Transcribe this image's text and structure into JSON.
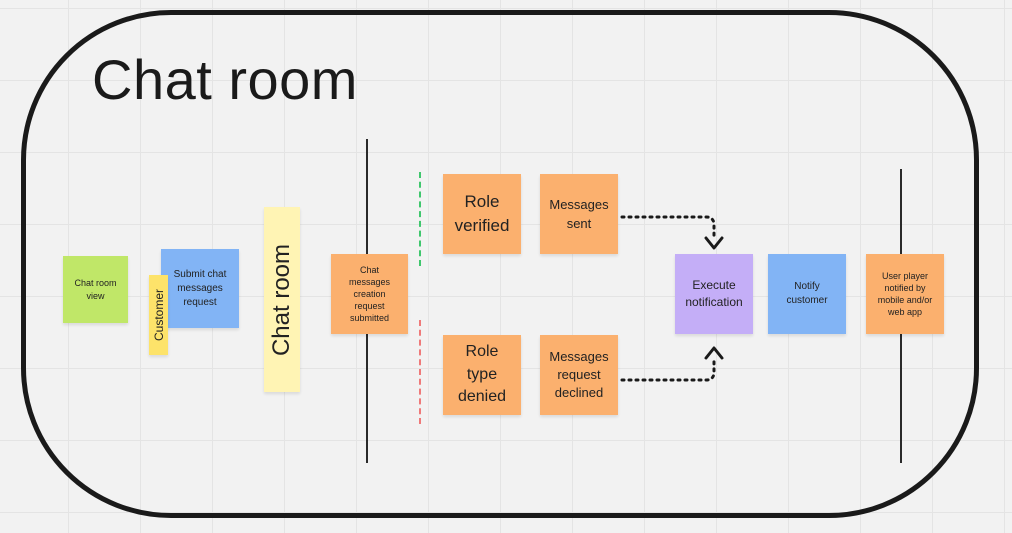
{
  "board": {
    "title": "Chat room"
  },
  "colors": {
    "green": "#c0e768",
    "blue": "#82b4f5",
    "yellow": "#fff4b4",
    "yellow_tag": "#fde36a",
    "orange": "#fbb06e",
    "purple": "#c4aef7",
    "dash_green": "#3fc76d",
    "dash_red": "#ef7a7a"
  },
  "notes": {
    "chat_room_view": "Chat room\nview",
    "submit_request": "Submit chat\nmessages\nrequest",
    "customer_tag": "Customer",
    "chat_room_label": "Chat room",
    "creation_submitted": "Chat\nmessages\ncreation\nrequest\nsubmitted",
    "role_verified": "Role\nverified",
    "messages_sent": "Messages\nsent",
    "role_type_denied": "Role\ntype\ndenied",
    "messages_request_declined": "Messages\nrequest\ndeclined",
    "execute_notification": "Execute\nnotification",
    "notify_customer": "Notify\ncustomer",
    "user_player_notified": "User player\nnotified by\nmobile and/or\nweb app"
  }
}
